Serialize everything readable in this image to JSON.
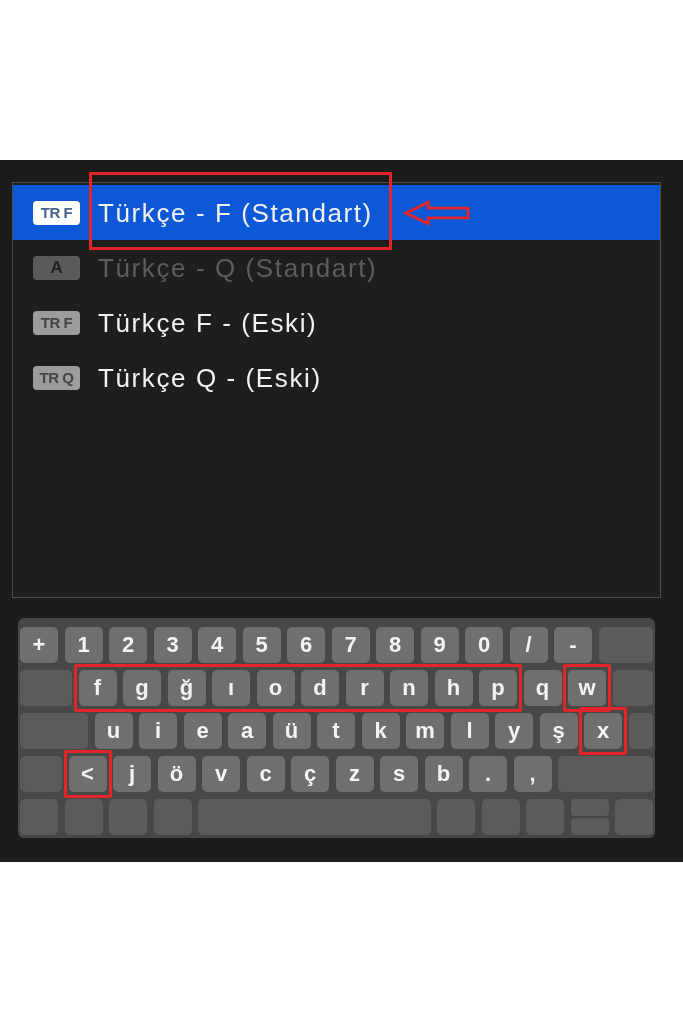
{
  "list": {
    "items": [
      {
        "badge": "TR F",
        "label": "Türkçe - F (Standart)",
        "selected": true,
        "disabled": false,
        "marked": true
      },
      {
        "badge": "A",
        "label": "Türkçe - Q (Standart)",
        "selected": false,
        "disabled": true,
        "marked": false
      },
      {
        "badge": "TR F",
        "label": "Türkçe F - (Eski)",
        "selected": false,
        "disabled": false,
        "marked": false
      },
      {
        "badge": "TR Q",
        "label": "Türkçe Q - (Eski)",
        "selected": false,
        "disabled": false,
        "marked": false
      }
    ]
  },
  "keyboard": {
    "rows": [
      {
        "groups": [
          {
            "kind": "plain",
            "keys": [
              {
                "kind": "char",
                "label": "+"
              },
              {
                "kind": "char",
                "label": "1"
              },
              {
                "kind": "char",
                "label": "2"
              },
              {
                "kind": "char",
                "label": "3"
              },
              {
                "kind": "char",
                "label": "4"
              },
              {
                "kind": "char",
                "label": "5"
              },
              {
                "kind": "char",
                "label": "6"
              },
              {
                "kind": "char",
                "label": "7"
              },
              {
                "kind": "char",
                "label": "8"
              },
              {
                "kind": "char",
                "label": "9"
              },
              {
                "kind": "char",
                "label": "0"
              },
              {
                "kind": "char",
                "label": "/"
              },
              {
                "kind": "char",
                "label": "-"
              },
              {
                "kind": "blank"
              }
            ]
          }
        ]
      },
      {
        "groups": [
          {
            "kind": "plain",
            "keys": [
              {
                "kind": "blank"
              }
            ]
          },
          {
            "kind": "highlight",
            "keys": [
              {
                "kind": "char",
                "label": "f"
              },
              {
                "kind": "char",
                "label": "g"
              },
              {
                "kind": "char",
                "label": "ğ"
              },
              {
                "kind": "char",
                "label": "ı"
              },
              {
                "kind": "char",
                "label": "o"
              },
              {
                "kind": "char",
                "label": "d"
              },
              {
                "kind": "char",
                "label": "r"
              },
              {
                "kind": "char",
                "label": "n"
              },
              {
                "kind": "char",
                "label": "h"
              },
              {
                "kind": "char",
                "label": "p"
              }
            ]
          },
          {
            "kind": "plain",
            "keys": [
              {
                "kind": "char",
                "label": "q"
              }
            ]
          },
          {
            "kind": "highlight",
            "keys": [
              {
                "kind": "char",
                "label": "w"
              }
            ]
          },
          {
            "kind": "plain",
            "keys": [
              {
                "kind": "blank"
              }
            ]
          }
        ]
      },
      {
        "groups": [
          {
            "kind": "plain",
            "keys": [
              {
                "kind": "blank"
              },
              {
                "kind": "char",
                "label": "u"
              },
              {
                "kind": "char",
                "label": "i"
              },
              {
                "kind": "char",
                "label": "e"
              },
              {
                "kind": "char",
                "label": "a"
              },
              {
                "kind": "char",
                "label": "ü"
              },
              {
                "kind": "char",
                "label": "t"
              },
              {
                "kind": "char",
                "label": "k"
              },
              {
                "kind": "char",
                "label": "m"
              },
              {
                "kind": "char",
                "label": "l"
              },
              {
                "kind": "char",
                "label": "y"
              },
              {
                "kind": "char",
                "label": "ş"
              }
            ]
          },
          {
            "kind": "highlight",
            "keys": [
              {
                "kind": "char",
                "label": "x"
              }
            ]
          },
          {
            "kind": "plain",
            "keys": [
              {
                "kind": "blank"
              }
            ]
          }
        ]
      },
      {
        "groups": [
          {
            "kind": "plain",
            "keys": [
              {
                "kind": "blank"
              }
            ]
          },
          {
            "kind": "highlight",
            "keys": [
              {
                "kind": "char",
                "label": "<"
              }
            ]
          },
          {
            "kind": "plain",
            "keys": [
              {
                "kind": "char",
                "label": "j"
              },
              {
                "kind": "char",
                "label": "ö"
              },
              {
                "kind": "char",
                "label": "v"
              },
              {
                "kind": "char",
                "label": "c"
              },
              {
                "kind": "char",
                "label": "ç"
              },
              {
                "kind": "char",
                "label": "z"
              },
              {
                "kind": "char",
                "label": "s"
              },
              {
                "kind": "char",
                "label": "b"
              },
              {
                "kind": "char",
                "label": "."
              },
              {
                "kind": "char",
                "label": ","
              },
              {
                "kind": "blank"
              }
            ]
          }
        ]
      },
      {
        "groups": [
          {
            "kind": "plain",
            "keys": [
              {
                "kind": "blank"
              },
              {
                "kind": "blank"
              },
              {
                "kind": "blank"
              },
              {
                "kind": "blank"
              },
              {
                "kind": "space"
              },
              {
                "kind": "blank"
              },
              {
                "kind": "blank"
              },
              {
                "kind": "blank"
              },
              {
                "kind": "split"
              },
              {
                "kind": "blank"
              }
            ]
          }
        ]
      }
    ]
  }
}
